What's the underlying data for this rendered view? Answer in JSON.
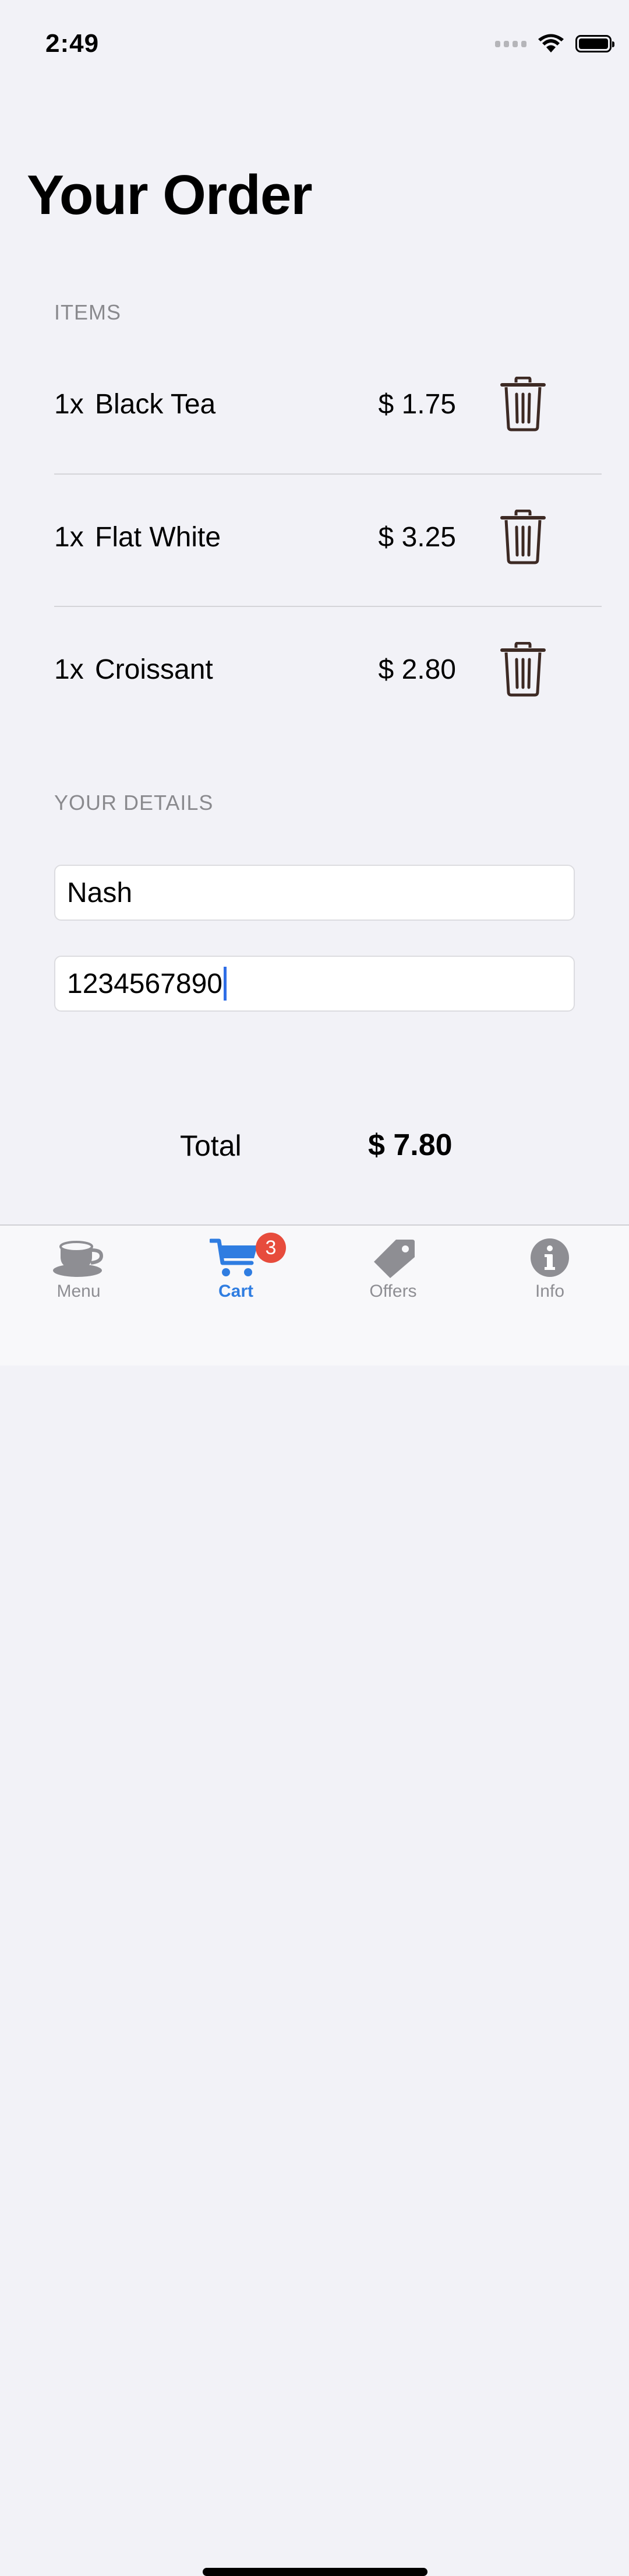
{
  "status_bar": {
    "time": "2:49"
  },
  "page_title": "Your Order",
  "items_section": {
    "header": "ITEMS",
    "items": [
      {
        "qty": "1x",
        "name": "Black Tea",
        "price": "$ 1.75"
      },
      {
        "qty": "1x",
        "name": "Flat White",
        "price": "$ 3.25"
      },
      {
        "qty": "1x",
        "name": "Croissant",
        "price": "$ 2.80"
      }
    ]
  },
  "details_section": {
    "header": "YOUR DETAILS",
    "name_value": "Nash",
    "phone_value": "1234567890"
  },
  "total": {
    "label": "Total",
    "value": "$ 7.80"
  },
  "tab_bar": {
    "tabs": [
      {
        "label": "Menu",
        "icon": "cup-icon"
      },
      {
        "label": "Cart",
        "icon": "cart-icon",
        "badge": "3",
        "active": true
      },
      {
        "label": "Offers",
        "icon": "tag-icon"
      },
      {
        "label": "Info",
        "icon": "info-icon"
      }
    ]
  },
  "colors": {
    "accent": "#2f7de1",
    "badge": "#e74c3c",
    "trash": "#3d2a24",
    "background": "#f2f2f7"
  }
}
